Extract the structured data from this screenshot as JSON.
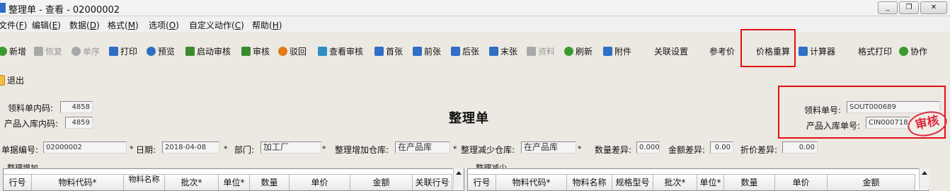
{
  "window": {
    "title": "整理单 - 查看 - 02000002",
    "buttons": [
      "_",
      "❐",
      "✕"
    ]
  },
  "menu": [
    {
      "label": "文件(",
      "key": "F",
      "end": ")"
    },
    {
      "label": "编辑(",
      "key": "E",
      "end": ")"
    },
    {
      "label": "数据(",
      "key": "D",
      "end": ")"
    },
    {
      "label": "格式(",
      "key": "M",
      "end": ")"
    },
    {
      "label": "选项(",
      "key": "O",
      "end": ")"
    },
    {
      "label": "自定义动作(",
      "key": "C",
      "end": ")"
    },
    {
      "label": "帮助(",
      "key": "H",
      "end": ")"
    }
  ],
  "toolbar": [
    {
      "label": "新增",
      "icon": "plus-icon",
      "color": "#3b9a2e",
      "disabled": false
    },
    {
      "label": "恢复",
      "icon": "undo-icon",
      "color": "#9a9a9a",
      "disabled": true
    },
    {
      "label": "单序",
      "icon": "sort-icon",
      "color": "#9a9a9a",
      "disabled": true
    },
    {
      "label": "打印",
      "icon": "print-icon",
      "color": "#2f6fc4",
      "disabled": false
    },
    {
      "label": "预览",
      "icon": "preview-icon",
      "color": "#2f6fc4",
      "disabled": false
    },
    {
      "label": "启动审核",
      "icon": "clipboard-icon",
      "color": "#3b8a2e",
      "disabled": false
    },
    {
      "label": "审核",
      "icon": "check-icon",
      "color": "#3b8a2e",
      "disabled": false
    },
    {
      "label": "驳回",
      "icon": "reject-icon",
      "color": "#e07a1a",
      "disabled": false
    },
    {
      "label": "查看审核",
      "icon": "view-audit-icon",
      "color": "#2f8fc4",
      "disabled": false
    },
    {
      "label": "首张",
      "icon": "first-icon",
      "color": "#2f6fc4",
      "disabled": false
    },
    {
      "label": "前张",
      "icon": "prev-icon",
      "color": "#2f6fc4",
      "disabled": false
    },
    {
      "label": "后张",
      "icon": "next-icon",
      "color": "#2f6fc4",
      "disabled": false
    },
    {
      "label": "末张",
      "icon": "last-icon",
      "color": "#2f6fc4",
      "disabled": false
    },
    {
      "label": "资料",
      "icon": "books-icon",
      "color": "#9a9a9a",
      "disabled": true
    },
    {
      "label": "刷新",
      "icon": "refresh-icon",
      "color": "#3b9a2e",
      "disabled": false
    },
    {
      "label": "附件",
      "icon": "attach-icon",
      "color": "#2f6fc4",
      "disabled": false
    },
    {
      "label": "关联设置",
      "icon": "",
      "color": "",
      "disabled": false
    },
    {
      "label": "参考价",
      "icon": "",
      "color": "",
      "disabled": false
    },
    {
      "label": "价格重算",
      "icon": "",
      "color": "",
      "disabled": false
    },
    {
      "label": "计算器",
      "icon": "calculator-icon",
      "color": "#2f6fc4",
      "disabled": false
    },
    {
      "label": "格式打印",
      "icon": "",
      "color": "",
      "disabled": false
    },
    {
      "label": "协作",
      "icon": "people-icon",
      "color": "#3b9a2e",
      "disabled": false
    }
  ],
  "exit": {
    "label": "退出",
    "icon": "exit-icon"
  },
  "form": {
    "title": "整理单",
    "receipt_inner_code_label": "领料单内码:",
    "receipt_inner_code": "4858",
    "product_inner_code_label": "产品入库内码:",
    "product_inner_code": "4859",
    "receipt_no_label": "领料单号:",
    "receipt_no": "SOUT000689",
    "product_no_label": "产品入库单号:",
    "product_no": "CIN000718",
    "stamp": "审核",
    "doc_no_label": "单据编号:",
    "doc_no": "02000002",
    "date_label": "日期:",
    "date": "2018-04-08",
    "dept_label": "部门:",
    "dept": "加工厂",
    "inc_wh_label": "整理增加仓库:",
    "inc_wh": "在产品库",
    "dec_wh_label": "整理减少仓库:",
    "dec_wh": "在产品库",
    "qty_diff_label": "数量差异:",
    "qty_diff": "0.000",
    "amt_diff_label": "金额差异:",
    "amt_diff": "0.00",
    "disc_diff_label": "折价差异:",
    "disc_diff": "0.00",
    "required_mark": "*"
  },
  "grid_increase": {
    "title": "整理增加",
    "columns": [
      "行号",
      "物料代码*",
      "物料名称",
      "批次*",
      "单位*",
      "数量",
      "单价",
      "金额",
      "关联行号"
    ]
  },
  "grid_decrease": {
    "title": "整理减少",
    "columns": [
      "行号",
      "物料代码*",
      "物料名称",
      "规格型号",
      "批次*",
      "单位*",
      "数量",
      "单价",
      "金额"
    ]
  },
  "highlight_color": "#e01010"
}
